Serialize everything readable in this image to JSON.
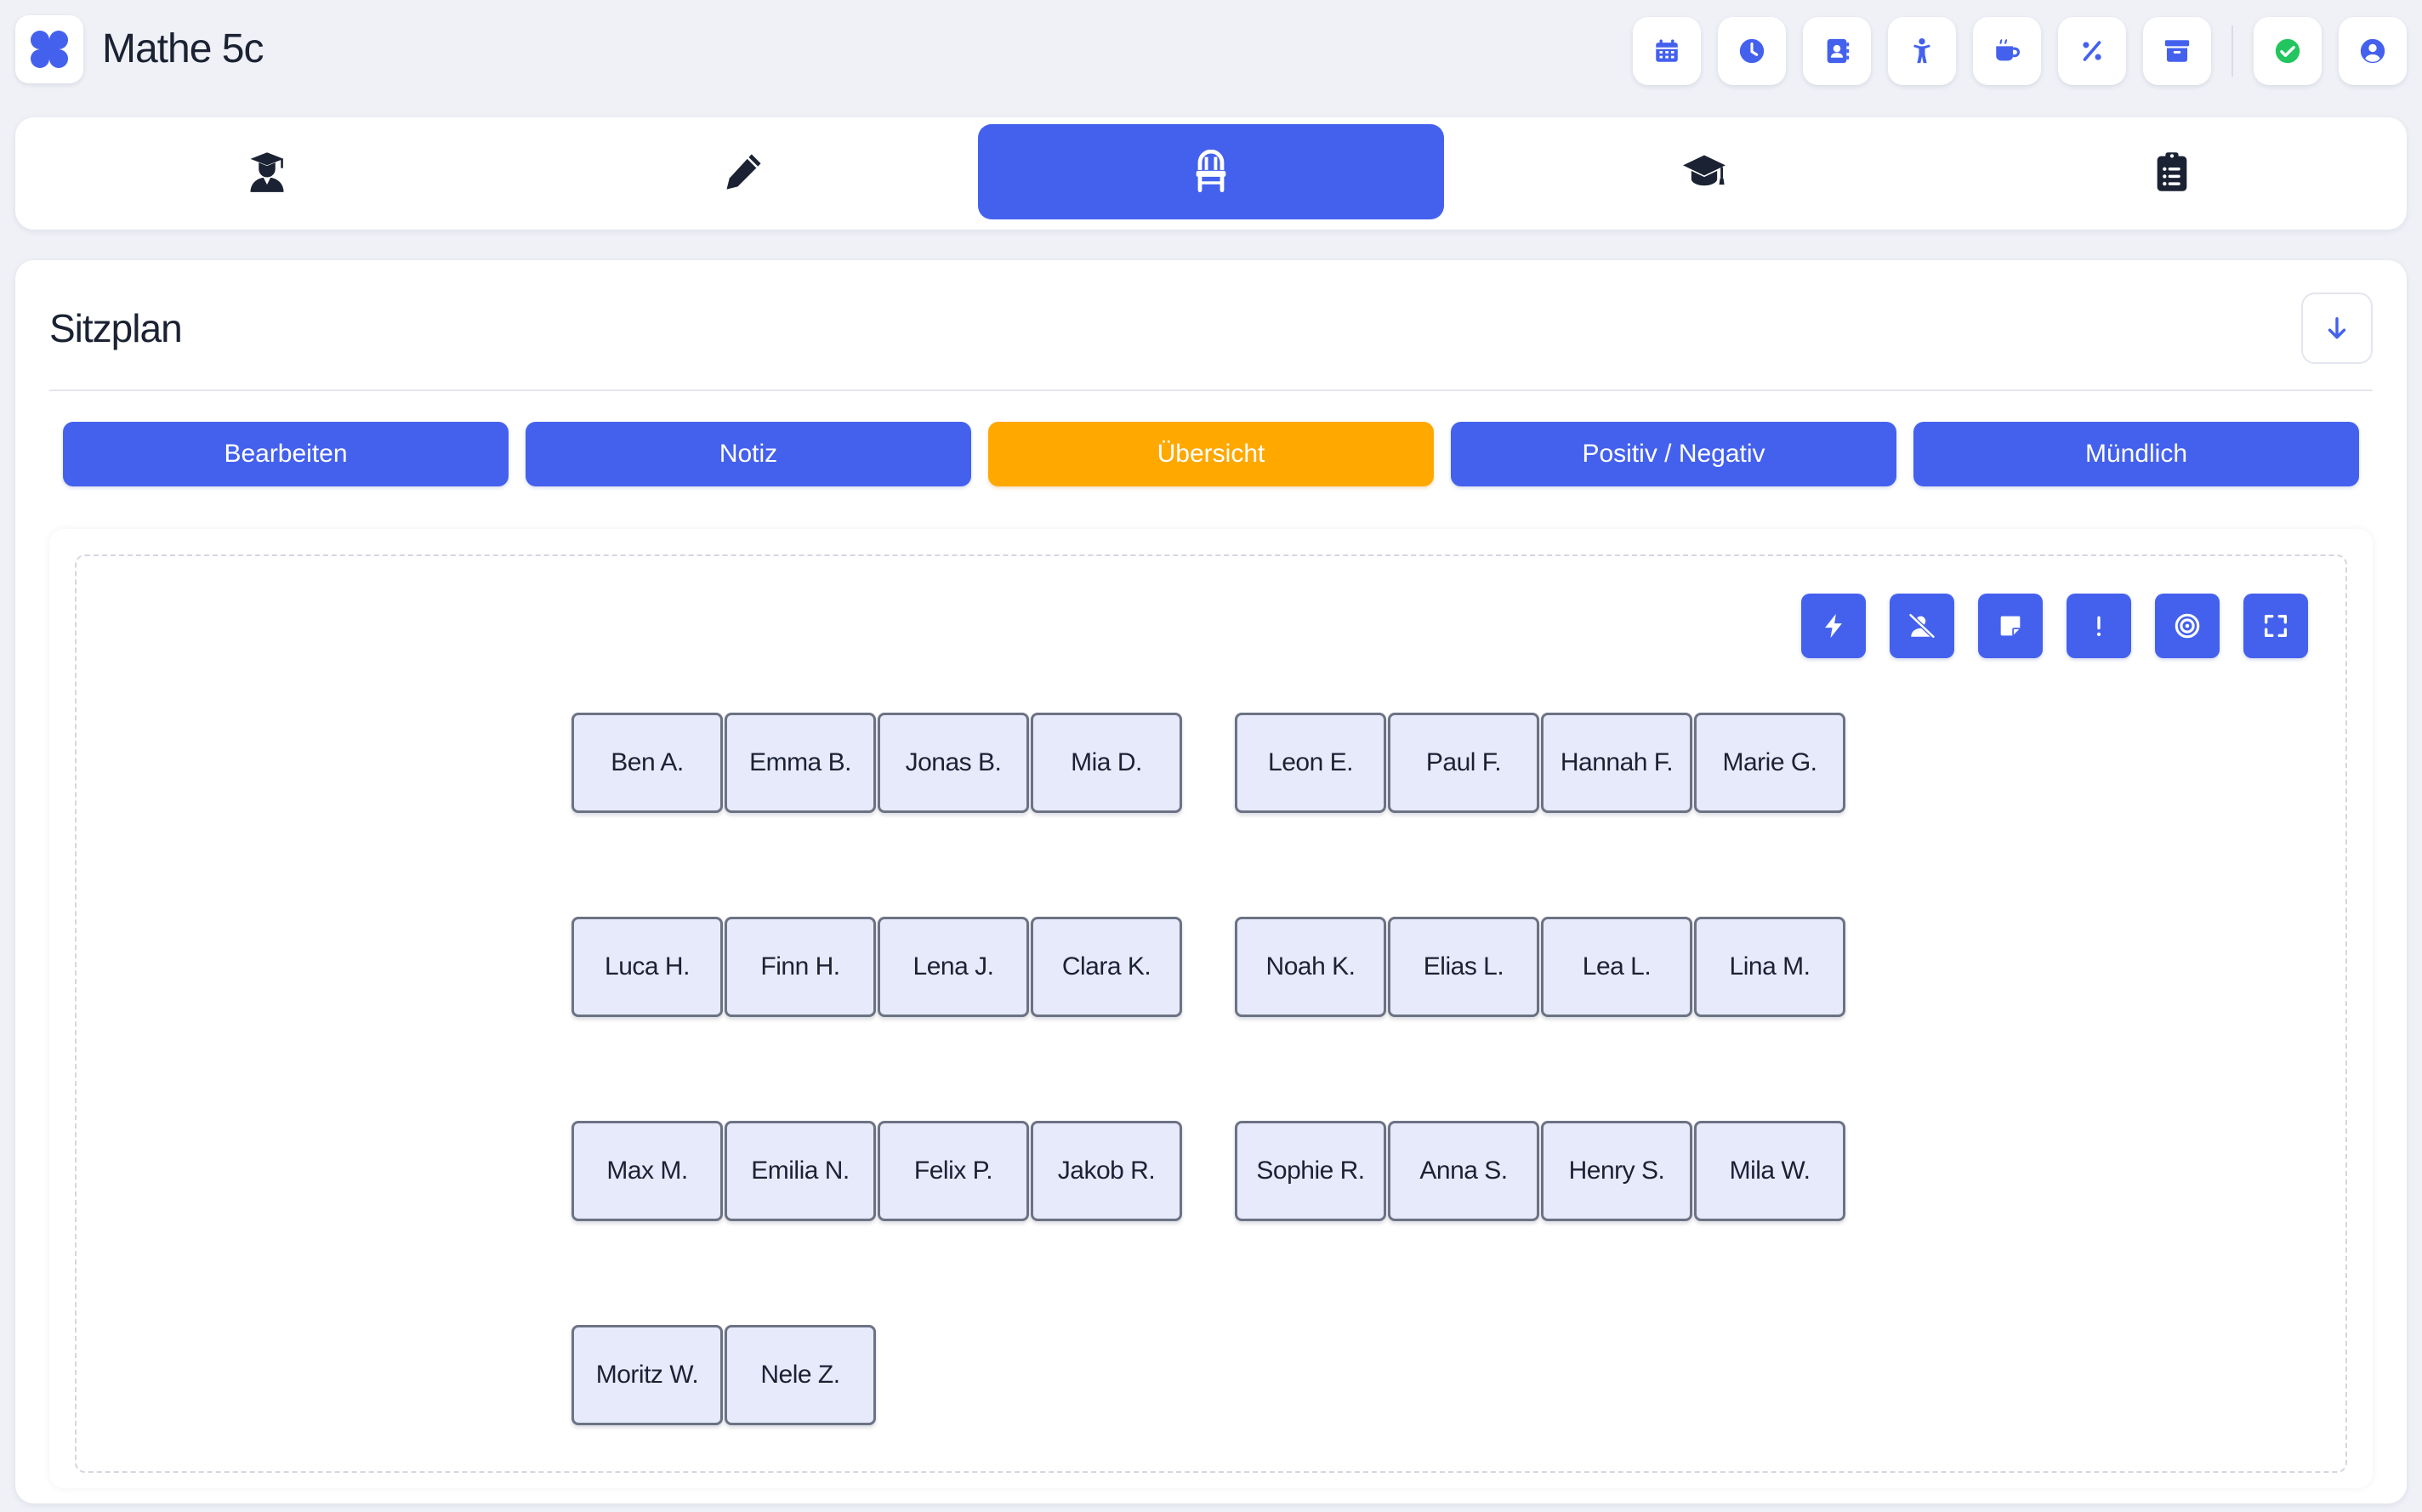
{
  "header": {
    "title": "Mathe 5c",
    "logo_icon": "four-blobs-logo-icon",
    "actions": [
      {
        "name": "calendar-button",
        "icon": "calendar-icon"
      },
      {
        "name": "clock-button",
        "icon": "clock-icon"
      },
      {
        "name": "contacts-button",
        "icon": "address-book-icon"
      },
      {
        "name": "child-button",
        "icon": "child-icon"
      },
      {
        "name": "break-button",
        "icon": "mug-icon"
      },
      {
        "name": "percent-button",
        "icon": "percent-icon"
      },
      {
        "name": "archive-button",
        "icon": "archive-icon"
      },
      {
        "name": "status-button",
        "icon": "check-circle-icon"
      },
      {
        "name": "profile-button",
        "icon": "user-circle-icon"
      }
    ]
  },
  "main_tabs": [
    {
      "name": "tab-teacher",
      "icon": "teacher-icon",
      "active": false
    },
    {
      "name": "tab-edit",
      "icon": "pencil-icon",
      "active": false
    },
    {
      "name": "tab-seating",
      "icon": "chair-icon",
      "active": true
    },
    {
      "name": "tab-grades",
      "icon": "graduation-cap-icon",
      "active": false
    },
    {
      "name": "tab-tasks",
      "icon": "clipboard-list-icon",
      "active": false
    }
  ],
  "section": {
    "title": "Sitzplan"
  },
  "modes": [
    {
      "label": "Bearbeiten",
      "active": false
    },
    {
      "label": "Notiz",
      "active": false
    },
    {
      "label": "Übersicht",
      "active": true
    },
    {
      "label": "Positiv / Negativ",
      "active": false
    },
    {
      "label": "Mündlich",
      "active": false
    }
  ],
  "tools": [
    {
      "name": "quick-action-button",
      "icon": "bolt-icon"
    },
    {
      "name": "absent-button",
      "icon": "user-slash-icon"
    },
    {
      "name": "note-button",
      "icon": "sticky-note-icon"
    },
    {
      "name": "warning-button",
      "icon": "exclamation-icon"
    },
    {
      "name": "target-button",
      "icon": "target-icon"
    },
    {
      "name": "fullscreen-button",
      "icon": "expand-icon"
    }
  ],
  "seat_rows": [
    [
      "Ben A.",
      "Emma B.",
      "Jonas B.",
      "Mia D.",
      "Leon E.",
      "Paul F.",
      "Hannah F.",
      "Marie G."
    ],
    [
      "Luca H.",
      "Finn H.",
      "Lena J.",
      "Clara K.",
      "Noah K.",
      "Elias L.",
      "Lea L.",
      "Lina M."
    ],
    [
      "Max M.",
      "Emilia N.",
      "Felix P.",
      "Jakob R.",
      "Sophie R.",
      "Anna S.",
      "Henry S.",
      "Mila W."
    ],
    [
      "Moritz W.",
      "Nele Z."
    ]
  ],
  "colors": {
    "primary": "#4461ee",
    "accent": "#ffa800",
    "success": "#22c55e",
    "seat_fill": "#e7eafb"
  }
}
